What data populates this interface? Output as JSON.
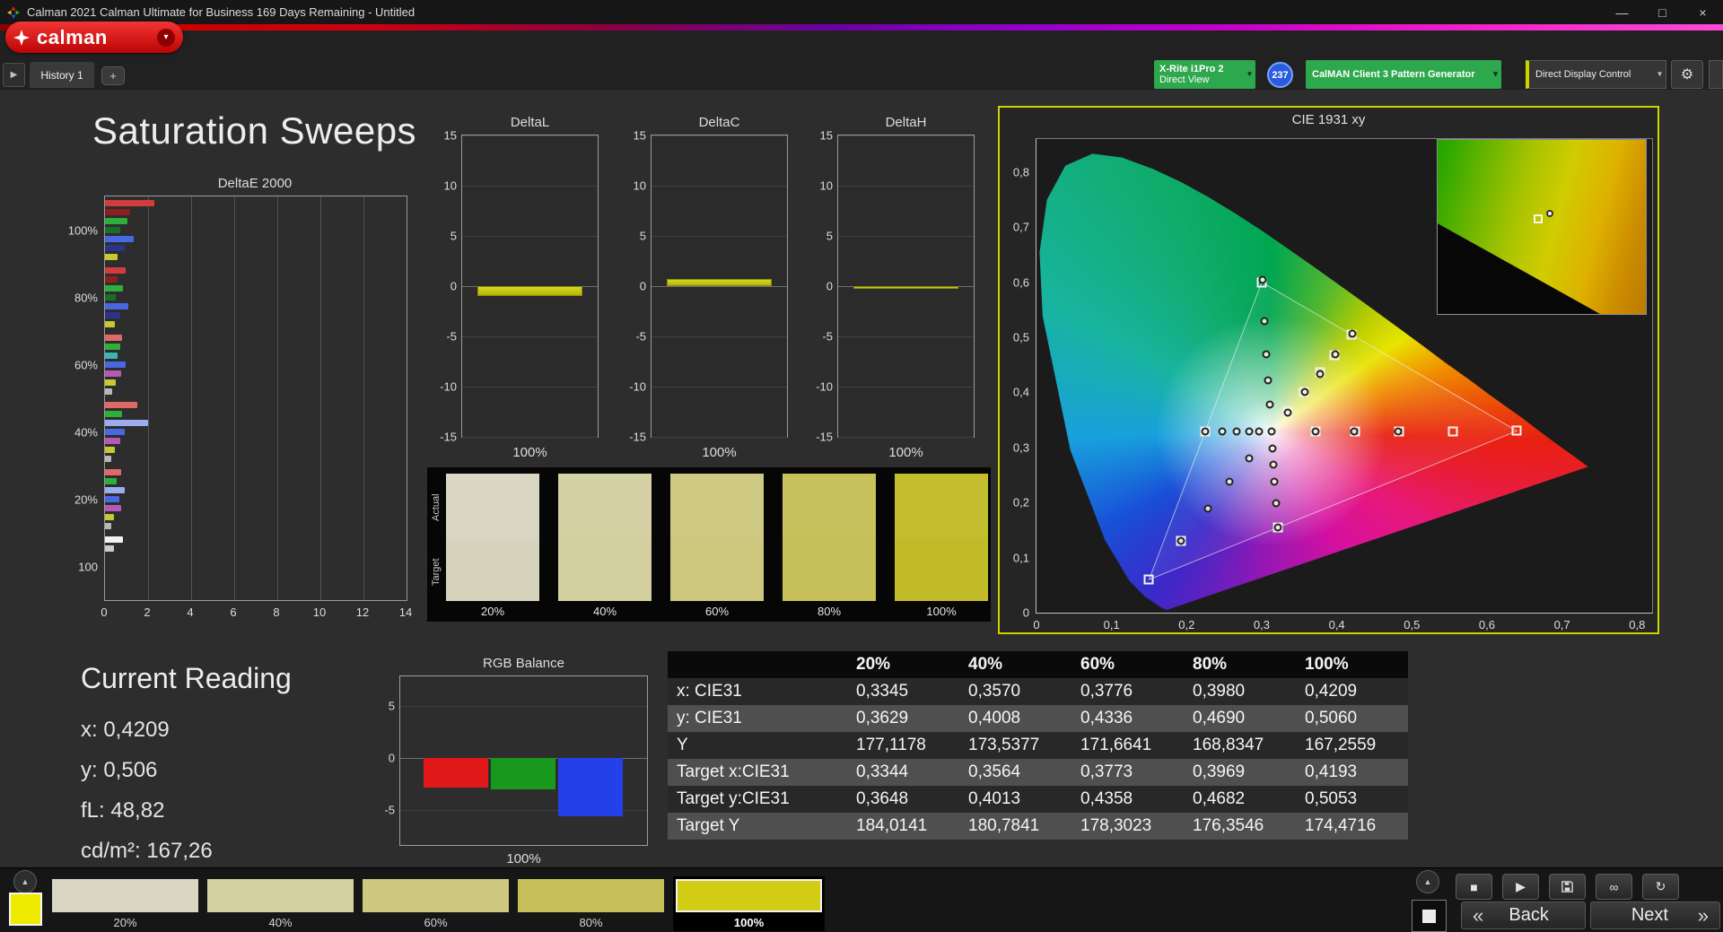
{
  "window": {
    "title": "Calman 2021 Calman Ultimate for Business 169 Days Remaining  - Untitled"
  },
  "icons": {
    "minimize": "—",
    "maximize": "□",
    "close": "×",
    "caret": "▾",
    "tab_play": "▶",
    "add_tab": "+",
    "gear": "⚙",
    "up_arrow": "▲",
    "stop": "■",
    "play": "▶",
    "link": "∞",
    "refresh": "↻",
    "back_chevron": "«",
    "next_chevron": "»"
  },
  "brand": {
    "logo_text": "calman"
  },
  "tabs": {
    "active": "History 1"
  },
  "toolbar": {
    "meter_line1": "X-Rite i1Pro 2",
    "meter_line2": "Direct View",
    "meter_badge": "237",
    "pattern": "CalMAN Client 3 Pattern Generator",
    "display_control": "Direct Display Control"
  },
  "page": {
    "title": "Saturation Sweeps"
  },
  "charts": {
    "deltae": {
      "type": "bar",
      "title": "DeltaE 2000",
      "xmax": 14,
      "xticks": [
        0,
        2,
        4,
        6,
        8,
        10,
        12,
        14
      ],
      "groups": [
        {
          "label": "100%",
          "bars": [
            [
              "#d23c3c",
              2.3
            ],
            [
              "#8a2020",
              1.15
            ],
            [
              "#2fae3c",
              1.05
            ],
            [
              "#1a6e26",
              0.7
            ],
            [
              "#4868e0",
              1.35
            ],
            [
              "#2a3488",
              0.9
            ],
            [
              "#c8c832",
              0.6
            ]
          ]
        },
        {
          "label": "80%",
          "bars": [
            [
              "#d23c3c",
              0.95
            ],
            [
              "#8a2020",
              0.6
            ],
            [
              "#2fae3c",
              0.85
            ],
            [
              "#1a6e26",
              0.5
            ],
            [
              "#4868e0",
              1.1
            ],
            [
              "#2a3488",
              0.7
            ],
            [
              "#c8c832",
              0.45
            ]
          ]
        },
        {
          "label": "60%",
          "bars": [
            [
              "#e06868",
              0.8
            ],
            [
              "#2fae3c",
              0.7
            ],
            [
              "#3cb4b4",
              0.6
            ],
            [
              "#4868e0",
              0.95
            ],
            [
              "#b45ab4",
              0.75
            ],
            [
              "#c8c832",
              0.5
            ],
            [
              "#b8b8b8",
              0.35
            ]
          ]
        },
        {
          "label": "40%",
          "bars": [
            [
              "#e06868",
              1.5
            ],
            [
              "#2fae3c",
              0.8
            ],
            [
              "#9cacf0",
              2.0
            ],
            [
              "#4868e0",
              0.9
            ],
            [
              "#b45ab4",
              0.7
            ],
            [
              "#c8c832",
              0.45
            ],
            [
              "#b8b8b8",
              0.3
            ]
          ]
        },
        {
          "label": "20%",
          "bars": [
            [
              "#e06868",
              0.75
            ],
            [
              "#2fae3c",
              0.55
            ],
            [
              "#9cacf0",
              0.9
            ],
            [
              "#4868e0",
              0.65
            ],
            [
              "#b45ab4",
              0.75
            ],
            [
              "#c8c832",
              0.4
            ],
            [
              "#b8b8b8",
              0.3
            ]
          ]
        },
        {
          "label": "100",
          "bars": [
            [
              "#f2f2f2",
              0.85
            ],
            [
              "#cccccc",
              0.4
            ]
          ]
        }
      ]
    },
    "delta": {
      "ymax": 15,
      "yticks": [
        15,
        10,
        5,
        0,
        -5,
        -10,
        -15
      ],
      "charts": [
        {
          "type": "bar",
          "title": "DeltaL",
          "xlabel": "100%",
          "value": -1.0
        },
        {
          "type": "bar",
          "title": "DeltaC",
          "xlabel": "100%",
          "value": 0.7
        },
        {
          "type": "bar",
          "title": "DeltaH",
          "xlabel": "100%",
          "value": -0.25
        }
      ]
    },
    "compare": {
      "row_labels": [
        "Actual",
        "Target"
      ],
      "columns": [
        {
          "label": "20%",
          "actual": "#d9d6c3",
          "target": "#d7d4bd"
        },
        {
          "label": "40%",
          "actual": "#d5d1a4",
          "target": "#d3cf9e"
        },
        {
          "label": "60%",
          "actual": "#cfca83",
          "target": "#cdc87d"
        },
        {
          "label": "80%",
          "actual": "#c8c25e",
          "target": "#c6c058"
        },
        {
          "label": "100%",
          "actual": "#c4bd2e",
          "target": "#c2bb28"
        }
      ]
    },
    "cie": {
      "type": "scatter",
      "title": "CIE 1931 xy",
      "xticks": [
        {
          "v": 0,
          "l": "0"
        },
        {
          "v": 0.1,
          "l": "0,1"
        },
        {
          "v": 0.2,
          "l": "0,2"
        },
        {
          "v": 0.3,
          "l": "0,3"
        },
        {
          "v": 0.4,
          "l": "0,4"
        },
        {
          "v": 0.5,
          "l": "0,5"
        },
        {
          "v": 0.6,
          "l": "0,6"
        },
        {
          "v": 0.7,
          "l": "0,7"
        },
        {
          "v": 0.8,
          "l": "0,8"
        }
      ],
      "yticks": [
        {
          "v": 0.8,
          "l": "0,8"
        },
        {
          "v": 0.7,
          "l": "0,7"
        },
        {
          "v": 0.6,
          "l": "0,6"
        },
        {
          "v": 0.5,
          "l": "0,5"
        },
        {
          "v": 0.4,
          "l": "0,4"
        },
        {
          "v": 0.3,
          "l": "0,3"
        },
        {
          "v": 0.2,
          "l": "0,2"
        },
        {
          "v": 0.1,
          "l": "0,1"
        },
        {
          "v": 0,
          "l": "0"
        }
      ],
      "gamut_triangle": [
        [
          0.64,
          0.33
        ],
        [
          0.3,
          0.6
        ],
        [
          0.15,
          0.06
        ]
      ],
      "targets": [
        [
          0.3127,
          0.329
        ],
        [
          0.3716,
          0.3292
        ],
        [
          0.424,
          0.3293
        ],
        [
          0.4829,
          0.3295
        ],
        [
          0.5549,
          0.3297
        ],
        [
          0.64,
          0.33
        ],
        [
          0.3344,
          0.3648
        ],
        [
          0.3564,
          0.4013
        ],
        [
          0.3773,
          0.4358
        ],
        [
          0.3969,
          0.4682
        ],
        [
          0.4193,
          0.5053
        ],
        [
          0.3,
          0.6
        ],
        [
          0.1923,
          0.1299
        ],
        [
          0.15,
          0.06
        ],
        [
          0.2246,
          0.329
        ],
        [
          0.3216,
          0.154
        ]
      ],
      "measured": [
        [
          0.3127,
          0.329
        ],
        [
          0.372,
          0.329
        ],
        [
          0.4235,
          0.3292
        ],
        [
          0.482,
          0.3294
        ],
        [
          0.3345,
          0.3629
        ],
        [
          0.357,
          0.4008
        ],
        [
          0.3776,
          0.4336
        ],
        [
          0.398,
          0.469
        ],
        [
          0.4209,
          0.506
        ],
        [
          0.3104,
          0.3778
        ],
        [
          0.3084,
          0.4211
        ],
        [
          0.3061,
          0.4699
        ],
        [
          0.3033,
          0.5295
        ],
        [
          0.301,
          0.605
        ],
        [
          0.2834,
          0.2806
        ],
        [
          0.2574,
          0.2375
        ],
        [
          0.2281,
          0.1891
        ],
        [
          0.193,
          0.131
        ],
        [
          0.2968,
          0.329
        ],
        [
          0.2827,
          0.329
        ],
        [
          0.2669,
          0.329
        ],
        [
          0.2475,
          0.329
        ],
        [
          0.225,
          0.3292
        ],
        [
          0.3143,
          0.2975
        ],
        [
          0.3157,
          0.2695
        ],
        [
          0.3173,
          0.238
        ],
        [
          0.3193,
          0.1995
        ],
        [
          0.3213,
          0.1555
        ]
      ]
    },
    "rgb": {
      "type": "bar",
      "title": "RGB Balance",
      "xlabel": "100%",
      "yticks": [
        5,
        0,
        -5
      ],
      "range_top": 7.8,
      "range_bottom": -8.3,
      "bars": [
        {
          "name": "red",
          "color": "#e01818",
          "value": -2.8
        },
        {
          "name": "green",
          "color": "#18981c",
          "value": -3.0
        },
        {
          "name": "blue",
          "color": "#2440e8",
          "value": -5.6
        }
      ]
    }
  },
  "reading": {
    "title": "Current Reading",
    "lines": [
      "x: 0,4209",
      "y: 0,506",
      "fL: 48,82",
      "cd/m²: 167,26"
    ]
  },
  "table": {
    "headers": [
      "",
      "20%",
      "40%",
      "60%",
      "80%",
      "100%"
    ],
    "rows": [
      {
        "label": "x: CIE31",
        "values": [
          "0,3345",
          "0,3570",
          "0,3776",
          "0,3980",
          "0,4209"
        ]
      },
      {
        "label": "y: CIE31",
        "values": [
          "0,3629",
          "0,4008",
          "0,4336",
          "0,4690",
          "0,5060"
        ]
      },
      {
        "label": "Y",
        "values": [
          "177,1178",
          "173,5377",
          "171,6641",
          "168,8347",
          "167,2559"
        ]
      },
      {
        "label": "Target x:CIE31",
        "values": [
          "0,3344",
          "0,3564",
          "0,3773",
          "0,3969",
          "0,4193"
        ]
      },
      {
        "label": "Target y:CIE31",
        "values": [
          "0,3648",
          "0,4013",
          "0,4358",
          "0,4682",
          "0,5053"
        ]
      },
      {
        "label": "Target Y",
        "values": [
          "184,0141",
          "180,7841",
          "178,3023",
          "176,3546",
          "174,4716"
        ]
      }
    ]
  },
  "bottom": {
    "back": "Back",
    "next": "Next",
    "swatches": [
      {
        "label": "20%",
        "color": "#d9d6c3",
        "active": false
      },
      {
        "label": "40%",
        "color": "#d4d0a1",
        "active": false
      },
      {
        "label": "60%",
        "color": "#cdc87f",
        "active": false
      },
      {
        "label": "80%",
        "color": "#c7c05a",
        "active": false
      },
      {
        "label": "100%",
        "color": "#d2cc14",
        "active": true
      }
    ]
  }
}
